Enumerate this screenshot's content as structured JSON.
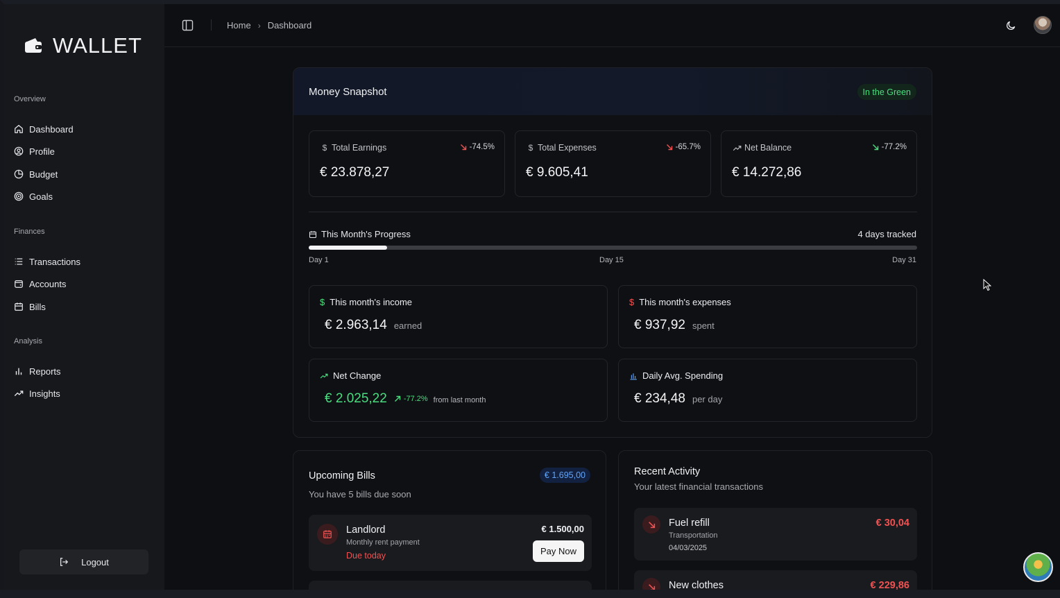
{
  "app": {
    "brand": "WALLET"
  },
  "sidebar": {
    "sections": [
      {
        "label": "Overview",
        "items": [
          {
            "label": "Dashboard",
            "icon": "home-icon"
          },
          {
            "label": "Profile",
            "icon": "user-circle-icon"
          },
          {
            "label": "Budget",
            "icon": "pie-chart-icon"
          },
          {
            "label": "Goals",
            "icon": "target-icon"
          }
        ]
      },
      {
        "label": "Finances",
        "items": [
          {
            "label": "Transactions",
            "icon": "list-icon"
          },
          {
            "label": "Accounts",
            "icon": "wallet-icon"
          },
          {
            "label": "Bills",
            "icon": "calendar-icon"
          }
        ]
      },
      {
        "label": "Analysis",
        "items": [
          {
            "label": "Reports",
            "icon": "bar-chart-icon"
          },
          {
            "label": "Insights",
            "icon": "trending-up-icon"
          }
        ]
      }
    ],
    "logout_label": "Logout"
  },
  "header": {
    "breadcrumbs": [
      "Home",
      "Dashboard"
    ]
  },
  "snapshot": {
    "title": "Money Snapshot",
    "status": "In the Green",
    "stats": [
      {
        "label": "Total Earnings",
        "change": "-74.5%",
        "value": "€ 23.878,27",
        "icon": "dollar-icon"
      },
      {
        "label": "Total Expenses",
        "change": "-65.7%",
        "value": "€ 9.605,41",
        "icon": "dollar-icon"
      },
      {
        "label": "Net Balance",
        "change": "-77.2%",
        "value": "€ 14.272,86",
        "icon": "trending-up-icon"
      }
    ],
    "progress": {
      "label": "This Month's Progress",
      "tracked": "4 days tracked",
      "fraction": 0.129,
      "ticks": [
        "Day 1",
        "Day 15",
        "Day 31"
      ]
    },
    "income": {
      "label": "This month's income",
      "value": "€ 2.963,14",
      "suffix": "earned"
    },
    "expenses": {
      "label": "This month's expenses",
      "value": "€ 937,92",
      "suffix": "spent"
    },
    "net_change": {
      "label": "Net Change",
      "value": "€ 2.025,22",
      "pct": "-77.2%",
      "suffix": "from last month"
    },
    "daily_avg": {
      "label": "Daily Avg. Spending",
      "value": "€ 234,48",
      "suffix": "per day"
    }
  },
  "bills": {
    "title": "Upcoming Bills",
    "subtitle": "You have 5 bills due soon",
    "total": "€ 1.695,00",
    "items": [
      {
        "name": "Landlord",
        "desc": "Monthly rent payment",
        "due": "Due today",
        "amount": "€ 1.500,00",
        "action": "Pay Now"
      }
    ]
  },
  "activity": {
    "title": "Recent Activity",
    "subtitle": "Your latest financial transactions",
    "items": [
      {
        "name": "Fuel refill",
        "category": "Transportation",
        "date": "04/03/2025",
        "amount": "€ 30,04"
      },
      {
        "name": "New clothes",
        "amount": "€ 229,86"
      }
    ]
  },
  "colors": {
    "positive": "#4ade80",
    "negative": "#f05252",
    "accent_blue": "#60a5fa"
  }
}
